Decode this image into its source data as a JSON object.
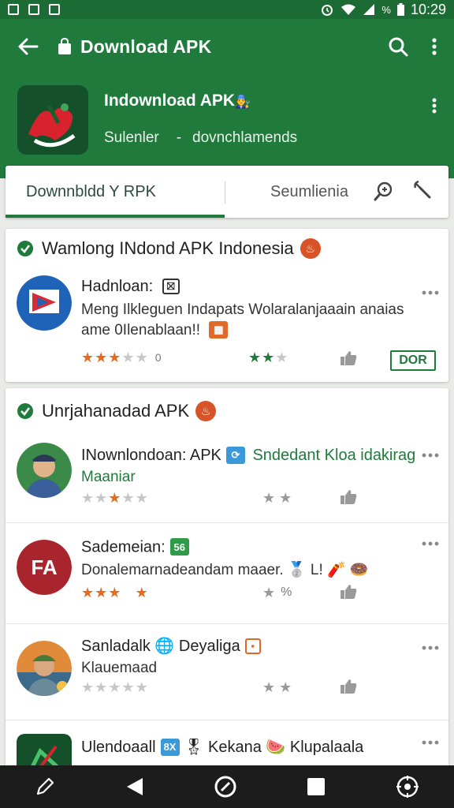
{
  "status": {
    "battery": "%",
    "time": "10:29"
  },
  "appbar": {
    "title": "Download APK"
  },
  "hero": {
    "title": "Indownload APK",
    "title_emoji": "🧑‍🔧",
    "sub_left": "Sulenler",
    "sub_right": "dovnchlamends"
  },
  "tabs": {
    "active": "Downnbldd Y RPK",
    "inactive": "Seumlienia"
  },
  "section1": {
    "heading": "Wamlong INdond APK Indonesia",
    "badge": "♨",
    "item": {
      "name": "Hadnloan:",
      "tag": "⛝",
      "desc_line1": "Meng Ilkleguen Indapats Wolaralanjaaain anaias",
      "desc_line2": "ame 0Ilenablaan!!",
      "rating_stars": 3,
      "rating_small": "0",
      "rating2_stars": 2,
      "button": "DOR"
    }
  },
  "section2": {
    "heading": "Unrjahanadad APK",
    "badge": "♨",
    "items": [
      {
        "name": "INownlondoan: APK",
        "tag": "⟳",
        "extra": "Sndedant Kloa idakirag",
        "desc": "Maaniar",
        "stars": 2,
        "rating2": "",
        "rating2_stars": 2
      },
      {
        "name": "Sademeian:",
        "tag": "56",
        "extra": "",
        "desc": "Donalemarnadeandam maaer. 🥈 L! 🧨 🍩",
        "stars": 3,
        "rating2": "%",
        "rating2_stars": 1
      },
      {
        "name": "Sanladalk",
        "tag": "🌐",
        "extra": "Deyaliga",
        "desc": "Klauemaad",
        "stars": 0,
        "rating2": "",
        "rating2_stars": 2
      },
      {
        "name": "Ulendoaall",
        "tag": "8X",
        "extra": "🎖 Kekana 🍉 Klupalaala",
        "desc": "",
        "stars": 0,
        "rating2": "",
        "rating2_stars": 0
      }
    ]
  },
  "colors": {
    "primary": "#1f7a3b",
    "star": "#e46a1e",
    "badge": "#d65428"
  },
  "icons": [
    "back-arrow-icon",
    "shopping-bag-icon",
    "search-icon",
    "more-vert-icon",
    "zoom-icon",
    "wrench-icon",
    "check-circle-icon",
    "thumbs-up-icon",
    "edit-icon",
    "nav-back-icon",
    "nav-home-icon",
    "nav-recents-icon",
    "nav-assistant-icon"
  ]
}
